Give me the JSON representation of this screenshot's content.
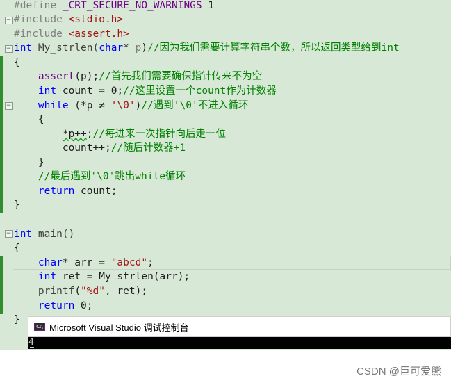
{
  "editor": {
    "lines": {
      "l1": {
        "p1": "#define ",
        "p2": "_CRT_SECURE_NO_WARNINGS",
        "p3": " 1"
      },
      "l2": {
        "p1": "#include ",
        "p2": "<stdio.h>"
      },
      "l3": {
        "p1": "#include ",
        "p2": "<assert.h>"
      },
      "l4": {
        "p1": "int",
        "p2": " My_strlen(",
        "p3": "char",
        "p4": "* ",
        "p5": "p",
        "p6": ")",
        "p7": "//因为我们需要计算字符串个数，所以返回类型给到int"
      },
      "l5": {
        "p1": "{"
      },
      "l6": {
        "p1": "    ",
        "p2": "assert",
        "p3": "(p);",
        "p4": "//首先我们需要确保指针传来不为空"
      },
      "l7": {
        "p1": "    ",
        "p2": "int",
        "p3": " count = 0;",
        "p4": "//这里设置一个count作为计数器"
      },
      "l8": {
        "p1": "    ",
        "p2": "while",
        "p3": " (*p ≠ ",
        "p4": "'\\0'",
        "p5": ")",
        "p6": "//遇到'\\0'不进入循环"
      },
      "l9": {
        "p1": "    {"
      },
      "l10": {
        "p1": "        ",
        "p2": "*p++",
        "p3": ";",
        "p4": "//每进来一次指针向后走一位"
      },
      "l11": {
        "p1": "        ",
        "p2": "count++;",
        "p3": "//随后计数器+1"
      },
      "l12": {
        "p1": "    }"
      },
      "l13": {
        "p1": "    ",
        "p2": "//最后遇到'\\0'跳出while循环"
      },
      "l14": {
        "p1": "    ",
        "p2": "return",
        "p3": " count;"
      },
      "l15": {
        "p1": "}"
      },
      "l16": {
        "p1": ""
      },
      "l17": {
        "p1": "int",
        "p2": " main()"
      },
      "l18": {
        "p1": "{"
      },
      "l19": {
        "p1": "    ",
        "p2": "char",
        "p3": "* arr = ",
        "p4": "\"abcd\"",
        "p5": ";"
      },
      "l20": {
        "p1": "    ",
        "p2": "int",
        "p3": " ret = My_strlen(arr);"
      },
      "l21": {
        "p1": "    ",
        "p2": "printf",
        "p3": "(",
        "p4": "\"%d\"",
        "p5": ", ret);"
      },
      "l22": {
        "p1": "    ",
        "p2": "return",
        "p3": " 0;"
      },
      "l23": {
        "p1": "}"
      }
    },
    "fold_glyph": "−"
  },
  "console": {
    "icon_text": "C:\\",
    "title": "Microsoft Visual Studio 调试控制台",
    "output": "4"
  },
  "watermark": "CSDN @巨可爱熊",
  "colors": {
    "editor_bg": "#d8e8d6",
    "keyword": "#0000ff",
    "string": "#a31515",
    "comment": "#008000",
    "preprocessor": "#808080",
    "change_bar": "#2f8f2f"
  }
}
